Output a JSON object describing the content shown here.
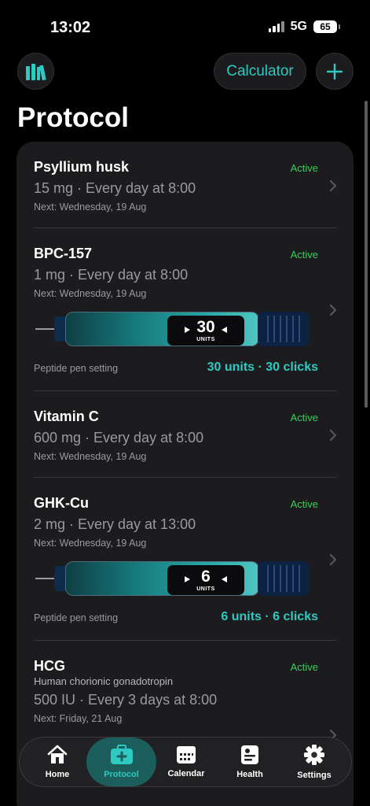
{
  "status_bar": {
    "time": "13:02",
    "network": "5G",
    "battery": "65"
  },
  "header": {
    "title": "Protocol",
    "calculator_label": "Calculator"
  },
  "protocols": [
    {
      "name": "Psyllium husk",
      "subname": "",
      "dose": "15 mg · Every day at 8:00",
      "next": "Next: Wednesday, 19 Aug",
      "status": "Active"
    },
    {
      "name": "BPC-157",
      "subname": "",
      "dose": "1 mg · Every day at 8:00",
      "next": "Next: Wednesday, 19 Aug",
      "status": "Active",
      "pen": {
        "number": "30",
        "unit": "UNITS",
        "label": "Peptide pen setting",
        "value": "30 units · 30 clicks"
      }
    },
    {
      "name": "Vitamin C",
      "subname": "",
      "dose": "600 mg · Every day at 8:00",
      "next": "Next: Wednesday, 19 Aug",
      "status": "Active"
    },
    {
      "name": "GHK-Cu",
      "subname": "",
      "dose": "2 mg · Every day at 13:00",
      "next": "Next: Wednesday, 19 Aug",
      "status": "Active",
      "pen": {
        "number": "6",
        "unit": "UNITS",
        "label": "Peptide pen setting",
        "value": "6 units · 6 clicks"
      }
    },
    {
      "name": "HCG",
      "subname": "Human chorionic gonadotropin",
      "dose": "500 IU · Every 3 days at 8:00",
      "next": "Next: Friday, 21 Aug",
      "status": "Active"
    }
  ],
  "tabbar": {
    "active": "Protocol",
    "tabs": [
      {
        "label": "Home",
        "icon": "house-icon"
      },
      {
        "label": "Protocol",
        "icon": "medkit-icon"
      },
      {
        "label": "Calendar",
        "icon": "calendar-icon"
      },
      {
        "label": "Health",
        "icon": "health-record-icon"
      },
      {
        "label": "Settings",
        "icon": "gear-icon"
      }
    ]
  },
  "colors": {
    "accent": "#2ec9c1",
    "active_status": "#30d158",
    "card_bg": "#1c1c1e",
    "background": "#000000"
  }
}
